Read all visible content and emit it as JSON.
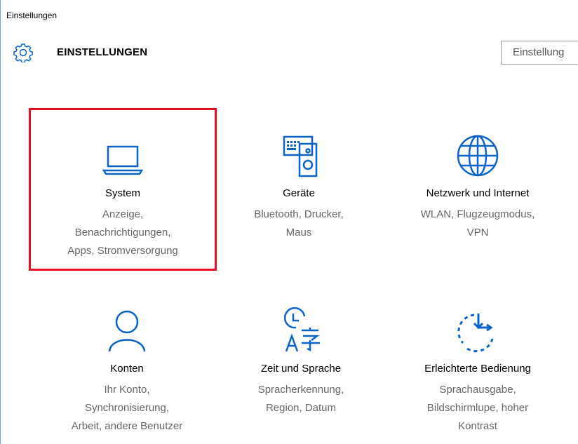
{
  "window": {
    "title": "Einstellungen"
  },
  "header": {
    "title": "EINSTELLUNGEN",
    "search_placeholder": "Einstellung",
    "icon": "gear-icon"
  },
  "tiles": [
    {
      "name": "System",
      "desc": [
        "Anzeige,",
        "Benachrichtigungen,",
        "Apps, Stromversorgung"
      ],
      "icon": "laptop-icon",
      "selected": true
    },
    {
      "name": "Geräte",
      "desc": [
        "Bluetooth, Drucker,",
        "Maus"
      ],
      "icon": "devices-icon",
      "selected": false
    },
    {
      "name": "Netzwerk und Internet",
      "desc": [
        "WLAN, Flugzeugmodus,",
        "VPN"
      ],
      "icon": "globe-icon",
      "selected": false
    },
    {
      "name": "Konten",
      "desc": [
        "Ihr Konto,",
        "Synchronisierung,",
        "Arbeit, andere Benutzer"
      ],
      "icon": "person-icon",
      "selected": false
    },
    {
      "name": "Zeit und Sprache",
      "desc": [
        "Spracherkennung,",
        "Region, Datum"
      ],
      "icon": "time-language-icon",
      "selected": false
    },
    {
      "name": "Erleichterte Bedienung",
      "desc": [
        "Sprachausgabe,",
        "Bildschirmlupe, hoher",
        "Kontrast"
      ],
      "icon": "accessibility-icon",
      "selected": false
    }
  ],
  "colors": {
    "accent": "#0a63c9",
    "selection": "#e81123"
  }
}
